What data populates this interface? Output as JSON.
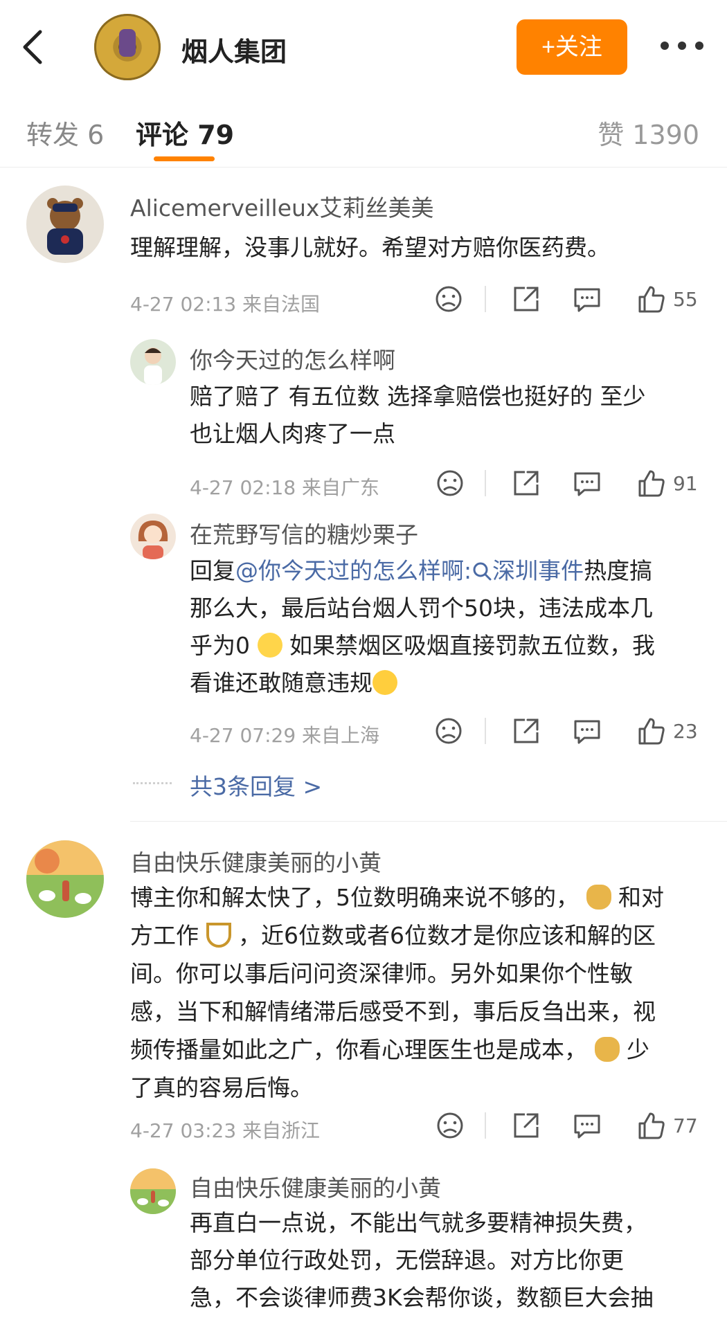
{
  "header": {
    "account_name": "烟人集团",
    "follow_label": "+关注"
  },
  "tabs": {
    "repost": "转发 6",
    "comments": "评论 79",
    "likes": "赞 1390"
  },
  "comments": [
    {
      "name": "Alicemerveilleux艾莉丝美美",
      "text": "理解理解，没事儿就好。希望对方赔你医药费。",
      "time": "4-27 02:13 来自法国",
      "likes": "55"
    },
    {
      "name": "你今天过的怎么样啊",
      "lines": [
        "赔了赔了 有五位数 选择拿赔偿也挺好的 至少",
        "也让烟人肉疼了一点"
      ],
      "time": "4-27 02:18 来自广东",
      "likes": "91"
    },
    {
      "name": "在荒野写信的糖炒栗子",
      "reply_prefix": "回复",
      "mention": "@你今天过的怎么样啊:",
      "topic": "深圳事件",
      "line1_rest": "热度搞",
      "line2": "那么大，最后站台烟人罚个50块，违法成本几",
      "line3a": "乎为0",
      "line3b": "如果禁烟区吸烟直接罚款五位数，我",
      "line4": "看谁还敢随意违规",
      "time": "4-27 07:29 来自上海",
      "likes": "23"
    },
    {
      "more_replies": "共3条回复 >"
    },
    {
      "name": "自由快乐健康美丽的小黄",
      "line1a": "博主你和解太快了，5位数明确来说不够的，",
      "line1b": "和对",
      "line2a": "方工作",
      "line2b": "，近6位数或者6位数才是你应该和解的区",
      "line3": "间。你可以事后问问资深律师。另外如果你个性敏",
      "line4": "感，当下和解情绪滞后感受不到，事后反刍出来，视",
      "line5a": "频传播量如此之广，你看心理医生也是成本，",
      "line5b": "少",
      "line6": "了真的容易后悔。",
      "time": "4-27 03:23 来自浙江",
      "likes": "77"
    },
    {
      "name": "自由快乐健康美丽的小黄",
      "lines": [
        "再直白一点说，不能出气就多要精神损失费，",
        "部分单位行政处罚，无偿辞退。对方比你更",
        "急，不会谈律师费3K会帮你谈，数额巨大会抽"
      ]
    }
  ],
  "colors": {
    "accent": "#ff8200",
    "link": "#4a6aa5"
  },
  "icons": [
    "back-arrow-icon",
    "more-icon",
    "dislike-face-icon",
    "share-icon",
    "comment-icon",
    "like-icon",
    "search-icon",
    "money-bag-emoji",
    "hook-emoji",
    "shrug-emoji",
    "eye-roll-emoji"
  ]
}
